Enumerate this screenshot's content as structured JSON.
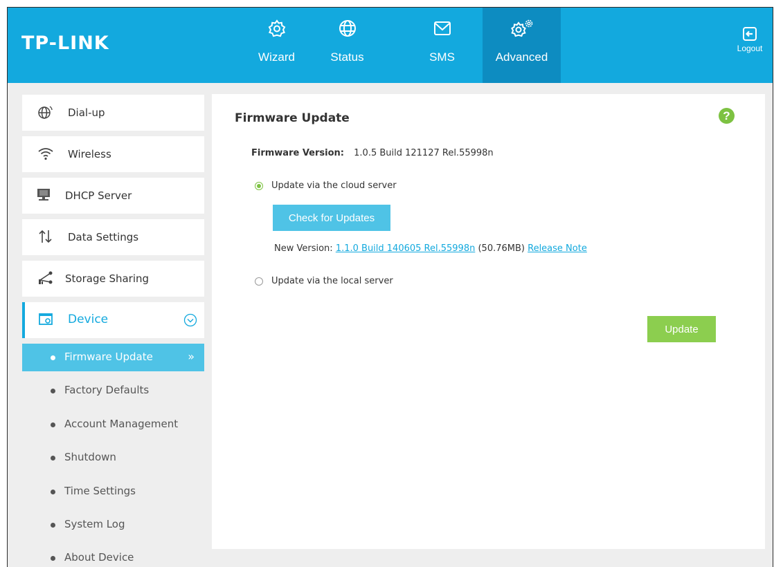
{
  "brand": {
    "logo_text": "TP-LINK",
    "header_color": "#13a9de",
    "accent": "#4fc3e6",
    "green": "#7dc242"
  },
  "nav": {
    "tabs": [
      {
        "label": "Wizard",
        "icon": "gear-icon"
      },
      {
        "label": "Status",
        "icon": "globe-icon"
      },
      {
        "label": "SMS",
        "icon": "envelope-icon"
      },
      {
        "label": "Advanced",
        "icon": "gears-icon",
        "active": true
      }
    ],
    "logout": {
      "label": "Logout",
      "icon": "logout-icon"
    }
  },
  "sidebar": {
    "items": [
      {
        "label": "Dial-up",
        "icon": "globe-signal-icon"
      },
      {
        "label": "Wireless",
        "icon": "wifi-icon"
      },
      {
        "label": "DHCP Server",
        "icon": "monitor-icon"
      },
      {
        "label": "Data Settings",
        "icon": "updown-arrows-icon"
      },
      {
        "label": "Storage Sharing",
        "icon": "share-icon"
      },
      {
        "label": "Device",
        "icon": "device-settings-icon",
        "expanded": true
      }
    ],
    "device_sub": [
      {
        "label": "Firmware Update",
        "active": true
      },
      {
        "label": "Factory Defaults"
      },
      {
        "label": "Account Management"
      },
      {
        "label": "Shutdown"
      },
      {
        "label": "Time Settings"
      },
      {
        "label": "System Log"
      },
      {
        "label": "About Device"
      }
    ]
  },
  "main": {
    "title": "Firmware Update",
    "help_icon": "?",
    "firmware_version_label": "Firmware Version:",
    "firmware_version_value": "1.0.5 Build 121127 Rel.55998n",
    "radio_cloud": "Update via the cloud server",
    "radio_local": "Update via the local server",
    "selected": "cloud",
    "check_button": "Check for Updates",
    "new_version_label": "New Version:",
    "new_version_link": "1.1.0 Build 140605 Rel.55998n",
    "new_version_size": "(50.76MB)",
    "release_note": "Release Note",
    "update_button": "Update"
  }
}
